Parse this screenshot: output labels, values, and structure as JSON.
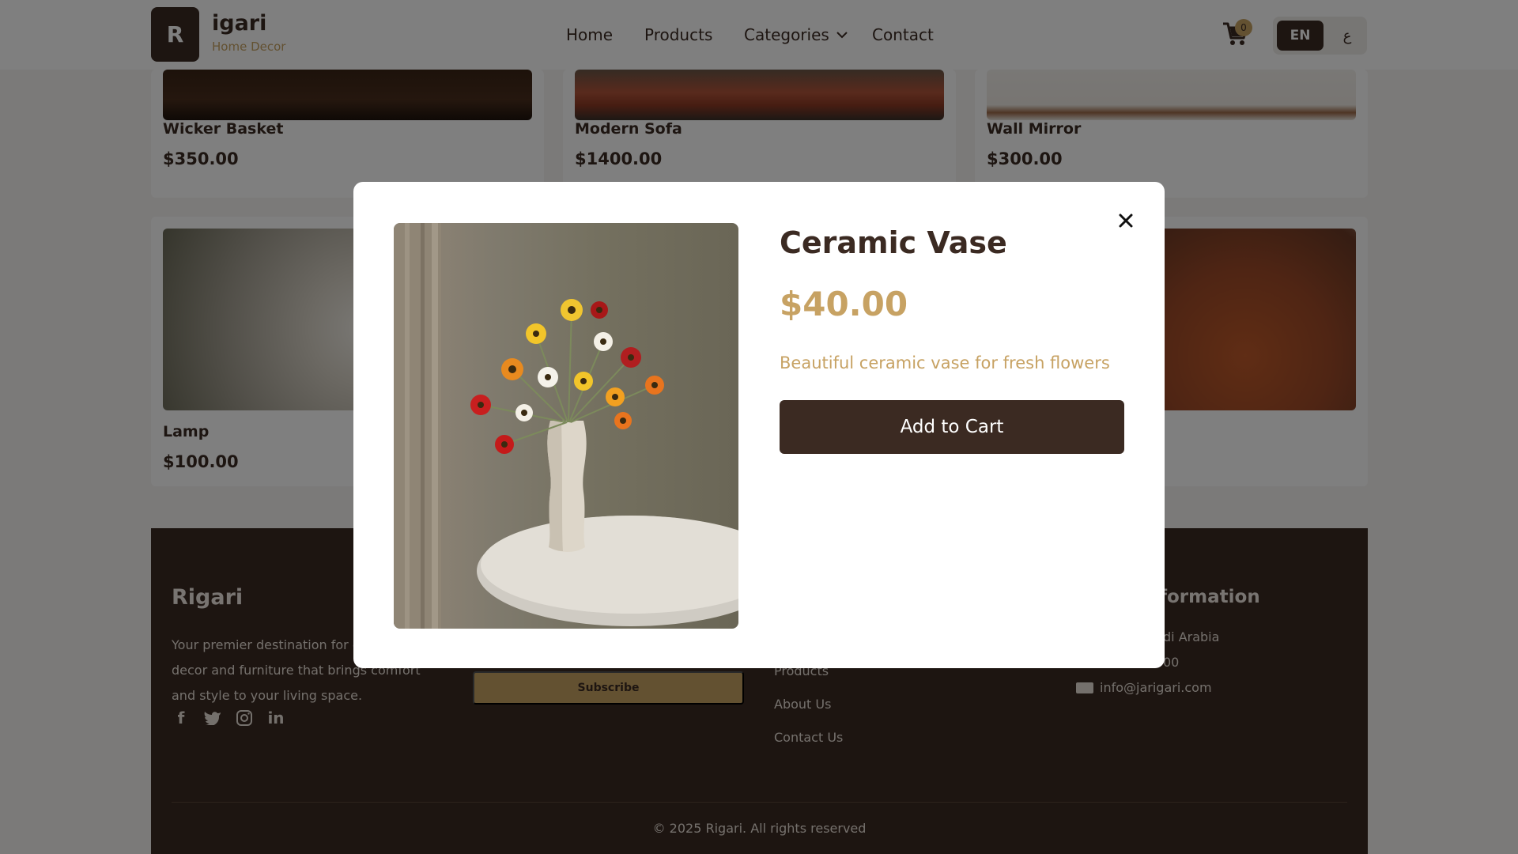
{
  "header": {
    "logo_letter": "R",
    "brand_name": "igari",
    "brand_tagline": "Home Decor",
    "nav": {
      "home": "Home",
      "products": "Products",
      "categories": "Categories",
      "contact": "Contact"
    },
    "cart_count": "0",
    "lang_en": "EN",
    "lang_ar": "ع"
  },
  "products": [
    {
      "name": "Wicker Basket",
      "price": "$350.00"
    },
    {
      "name": "Modern Sofa",
      "price": "$1400.00"
    },
    {
      "name": "Wall Mirror",
      "price": "$300.00"
    },
    {
      "name": "Lamp",
      "price": "$100.00"
    }
  ],
  "footer": {
    "brand": "Rigari",
    "description": "Your premier destination for elegant home decor and furniture that brings comfort and style to your living space.",
    "subscribe_label": "Subscribe",
    "links": {
      "products": "Products",
      "about": "About Us",
      "contact": "Contact Us"
    },
    "info_title": "formation",
    "info_location": "di Arabia",
    "info_phone": "00",
    "info_email": "info@jarigari.com",
    "copyright": "© 2025 Rigari. All rights reserved"
  },
  "modal": {
    "title": "Ceramic Vase",
    "price": "$40.00",
    "description": "Beautiful ceramic vase for fresh flowers",
    "add_to_cart": "Add to Cart",
    "close_symbol": "✕"
  },
  "colors": {
    "primary": "#3b2a22",
    "accent": "#c7a263",
    "background": "#f6f4f2"
  }
}
